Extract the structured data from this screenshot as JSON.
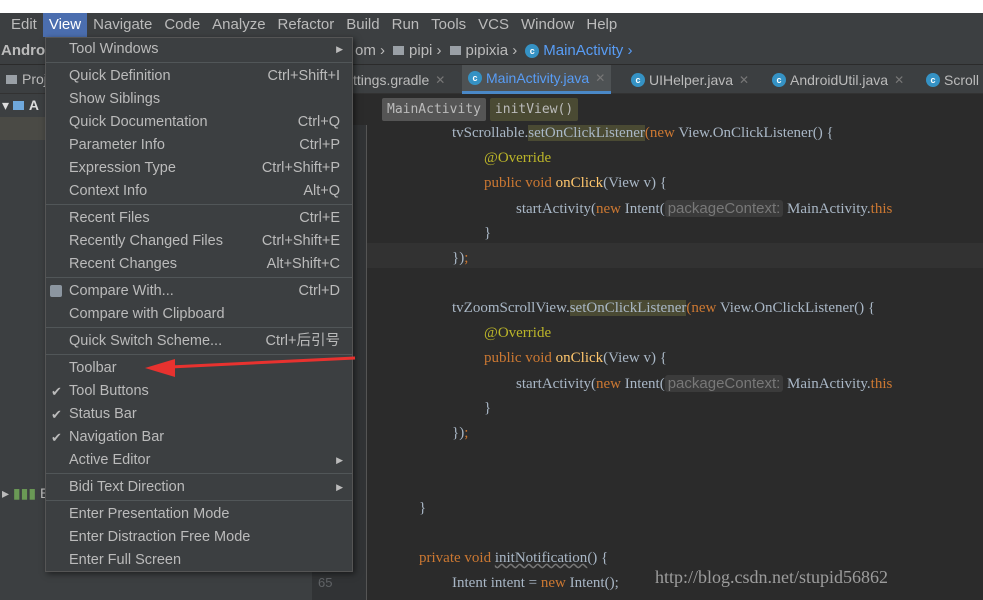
{
  "menubar": {
    "items": [
      "Edit",
      "View",
      "Navigate",
      "Code",
      "Analyze",
      "Refactor",
      "Build",
      "Run",
      "Tools",
      "VCS",
      "Window",
      "Help"
    ],
    "active": "View"
  },
  "navbar": {
    "project": "Androi",
    "crumbs": [
      "om",
      "pipi",
      "pipixia",
      "MainActivity"
    ]
  },
  "project_panel": {
    "header": "Proj",
    "root": "A",
    "bottom": "E"
  },
  "tabs": [
    {
      "label": "ttings.gradle"
    },
    {
      "label": "MainActivity.java",
      "active": true
    },
    {
      "label": "UIHelper.java"
    },
    {
      "label": "AndroidUtil.java"
    },
    {
      "label": "Scroll"
    }
  ],
  "breadcrumb": {
    "class": "MainActivity",
    "method": "initView()"
  },
  "gutter": {
    "line_number": "65"
  },
  "code": {
    "l1a": "tvScrollable.",
    "l1b": "setOnClickListener",
    "l1c": "(",
    "l1d": "new",
    " l1e": "",
    "l1f": " View.OnClickListener() {",
    "override": "@Override",
    "pub": "public void ",
    "onclick": "onClick",
    "onclick_args": "(View v) {",
    "start": "startActivity(",
    "new": "new",
    "intent": " Intent(",
    "hint": "packageContext:",
    "main_this": " MainActivity.",
    "this": "this",
    "close_brace": "}",
    "close_paren": "})",
    "semi": ";",
    "l2a": "tvZoomScrollView.",
    "private_kw": "private void ",
    "init_notif": "initNotification",
    "init_notif_rest": "() {",
    "intent_decl": "Intent intent = ",
    "intent_new_rest": " Intent();"
  },
  "menu": {
    "items": [
      {
        "label": "Tool Windows",
        "submenu": true
      },
      {
        "sep": true
      },
      {
        "label": "Quick Definition",
        "shortcut": "Ctrl+Shift+I"
      },
      {
        "label": "Show Siblings"
      },
      {
        "label": "Quick Documentation",
        "shortcut": "Ctrl+Q"
      },
      {
        "label": "Parameter Info",
        "shortcut": "Ctrl+P"
      },
      {
        "label": "Expression Type",
        "shortcut": "Ctrl+Shift+P"
      },
      {
        "label": "Context Info",
        "shortcut": "Alt+Q"
      },
      {
        "sep": true
      },
      {
        "label": "Recent Files",
        "shortcut": "Ctrl+E"
      },
      {
        "label": "Recently Changed Files",
        "shortcut": "Ctrl+Shift+E"
      },
      {
        "label": "Recent Changes",
        "shortcut": "Alt+Shift+C"
      },
      {
        "sep": true
      },
      {
        "label": "Compare With...",
        "shortcut": "Ctrl+D",
        "icon": "compare-icon"
      },
      {
        "label": "Compare with Clipboard"
      },
      {
        "sep": true
      },
      {
        "label": "Quick Switch Scheme...",
        "shortcut": "Ctrl+后引号"
      },
      {
        "sep": true
      },
      {
        "label": "Toolbar"
      },
      {
        "label": "Tool Buttons",
        "checked": true
      },
      {
        "label": "Status Bar",
        "checked": true
      },
      {
        "label": "Navigation Bar",
        "checked": true
      },
      {
        "label": "Active Editor",
        "submenu": true
      },
      {
        "sep": true
      },
      {
        "label": "Bidi Text Direction",
        "submenu": true
      },
      {
        "sep": true
      },
      {
        "label": "Enter Presentation Mode"
      },
      {
        "label": "Enter Distraction Free Mode"
      },
      {
        "label": "Enter Full Screen"
      }
    ]
  },
  "watermark": "http://blog.csdn.net/stupid56862",
  "colors": {
    "accent": "#4b6eaf",
    "annotation_arrow": "#e8322f"
  }
}
